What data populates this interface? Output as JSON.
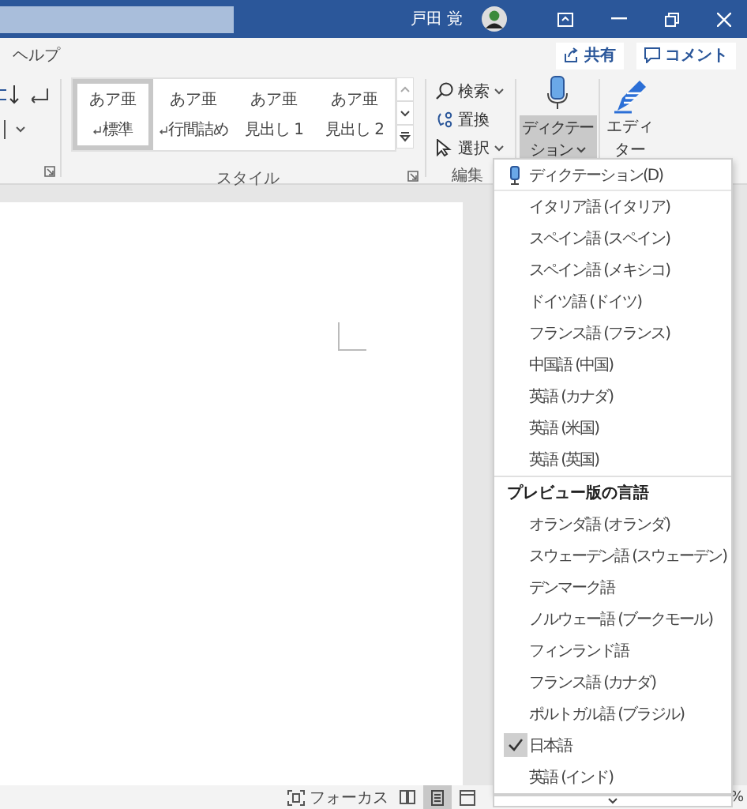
{
  "title_bar": {
    "user_name": "戸田 覚"
  },
  "tabs": [
    {
      "label": "ヘルプ",
      "selected": false
    }
  ],
  "share_button": {
    "label": "共有"
  },
  "comment_button": {
    "label": "コメント"
  },
  "ribbon": {
    "styles": [
      {
        "preview": "あア亜",
        "name": "標準",
        "paragraph_mark": true,
        "selected": true
      },
      {
        "preview": "あア亜",
        "name": "行間詰め",
        "paragraph_mark": true,
        "selected": false
      },
      {
        "preview": "あア亜",
        "name": "見出し 1",
        "paragraph_mark": false,
        "selected": false
      },
      {
        "preview": "あア亜",
        "name": "見出し 2",
        "paragraph_mark": false,
        "selected": false
      }
    ],
    "styles_label": "スタイル",
    "editing": [
      {
        "kind": "find",
        "label": "検索",
        "dropdown": true
      },
      {
        "kind": "replace",
        "label": "置換",
        "dropdown": false
      },
      {
        "kind": "select",
        "label": "選択",
        "dropdown": true
      }
    ],
    "editing_label": "編集",
    "dictation": {
      "lines": [
        "ディクテー",
        "ション"
      ]
    },
    "editor": {
      "lines": [
        "エディ",
        "ター"
      ]
    }
  },
  "dictation_menu": {
    "header": "ディクテーション(D)",
    "items": [
      {
        "label": "イタリア語 (イタリア)",
        "checked": false
      },
      {
        "label": "スペイン語 (スペイン)",
        "checked": false
      },
      {
        "label": "スペイン語 (メキシコ)",
        "checked": false
      },
      {
        "label": "ドイツ語 (ドイツ)",
        "checked": false
      },
      {
        "label": "フランス語 (フランス)",
        "checked": false
      },
      {
        "label": "中国語 (中国)",
        "checked": false
      },
      {
        "label": "英語 (カナダ)",
        "checked": false
      },
      {
        "label": "英語 (米国)",
        "checked": false
      },
      {
        "label": "英語 (英国)",
        "checked": false
      }
    ],
    "preview_header": "プレビュー版の言語",
    "preview_items": [
      {
        "label": "オランダ語 (オランダ)",
        "checked": false
      },
      {
        "label": "スウェーデン語 (スウェーデン)",
        "checked": false
      },
      {
        "label": "デンマーク語",
        "checked": false
      },
      {
        "label": "ノルウェー語 (ブークモール)",
        "checked": false
      },
      {
        "label": "フィンランド語",
        "checked": false
      },
      {
        "label": "フランス語 (カナダ)",
        "checked": false
      },
      {
        "label": "ポルトガル語 (ブラジル)",
        "checked": false
      },
      {
        "label": "日本語",
        "checked": true
      },
      {
        "label": "英語 (インド)",
        "checked": false
      }
    ]
  },
  "status_bar": {
    "focus": "フォーカス",
    "zoom_suffix": "%"
  }
}
